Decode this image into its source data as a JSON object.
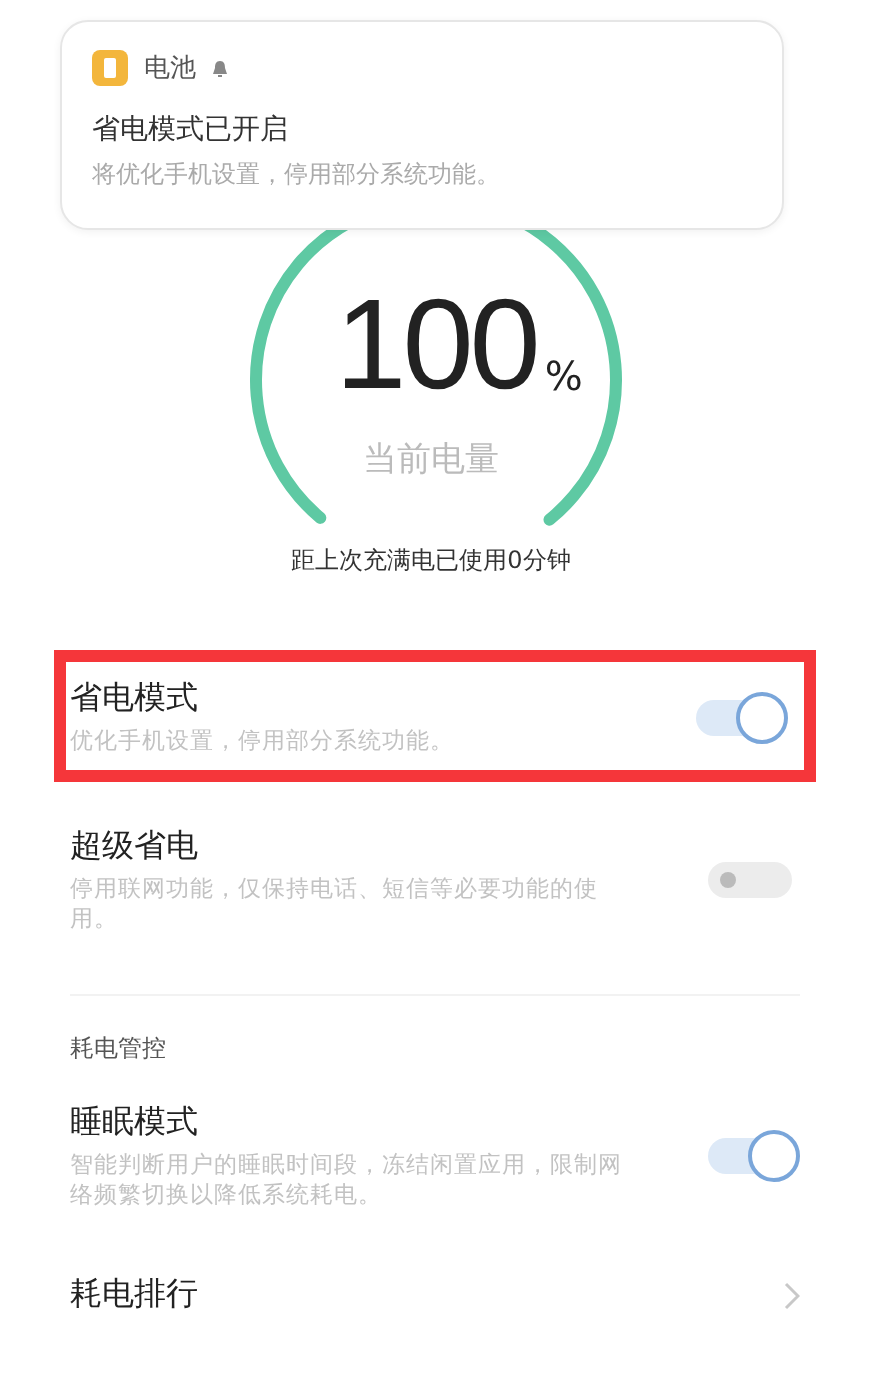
{
  "notification": {
    "app": "电池",
    "title": "省电模式已开启",
    "text": "将优化手机设置，停用部分系统功能。"
  },
  "battery": {
    "value": "100",
    "unit": "%",
    "label": "当前电量",
    "since_full": "距上次充满电已使用0分钟"
  },
  "settings": [
    {
      "kind": "toggle",
      "title": "省电模式",
      "description": "优化手机设置，停用部分系统功能。",
      "on": true,
      "highlighted": true
    },
    {
      "kind": "toggle",
      "title": "超级省电",
      "description": "停用联网功能，仅保持电话、短信等必要功能的使用。",
      "on": false,
      "highlighted": false
    },
    {
      "kind": "header",
      "title": "耗电管控"
    },
    {
      "kind": "toggle",
      "title": "睡眠模式",
      "description": "智能判断用户的睡眠时间段，冻结闲置应用，限制网络频繁切换以降低系统耗电。",
      "on": true,
      "highlighted": false
    },
    {
      "kind": "link",
      "title": "耗电排行"
    }
  ]
}
